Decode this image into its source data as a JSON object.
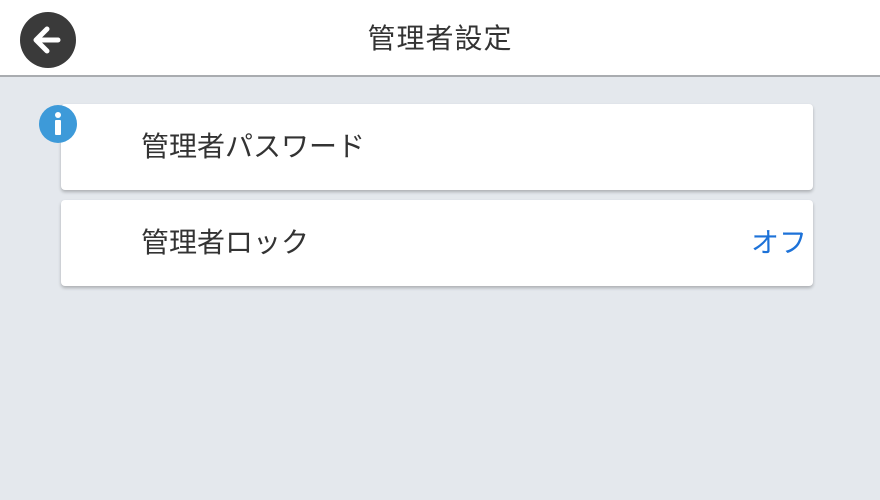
{
  "header": {
    "title": "管理者設定",
    "back_icon": "arrow-left-icon"
  },
  "menu": {
    "items": [
      {
        "label": "管理者パスワード",
        "value": "",
        "icon": "info-icon"
      },
      {
        "label": "管理者ロック",
        "value": "オフ"
      }
    ]
  },
  "colors": {
    "background": "#e4e8ed",
    "header_background": "#ffffff",
    "value_accent": "#1d72d8",
    "info_icon": "#3d9ad9",
    "back_button": "#3a3a3a"
  }
}
